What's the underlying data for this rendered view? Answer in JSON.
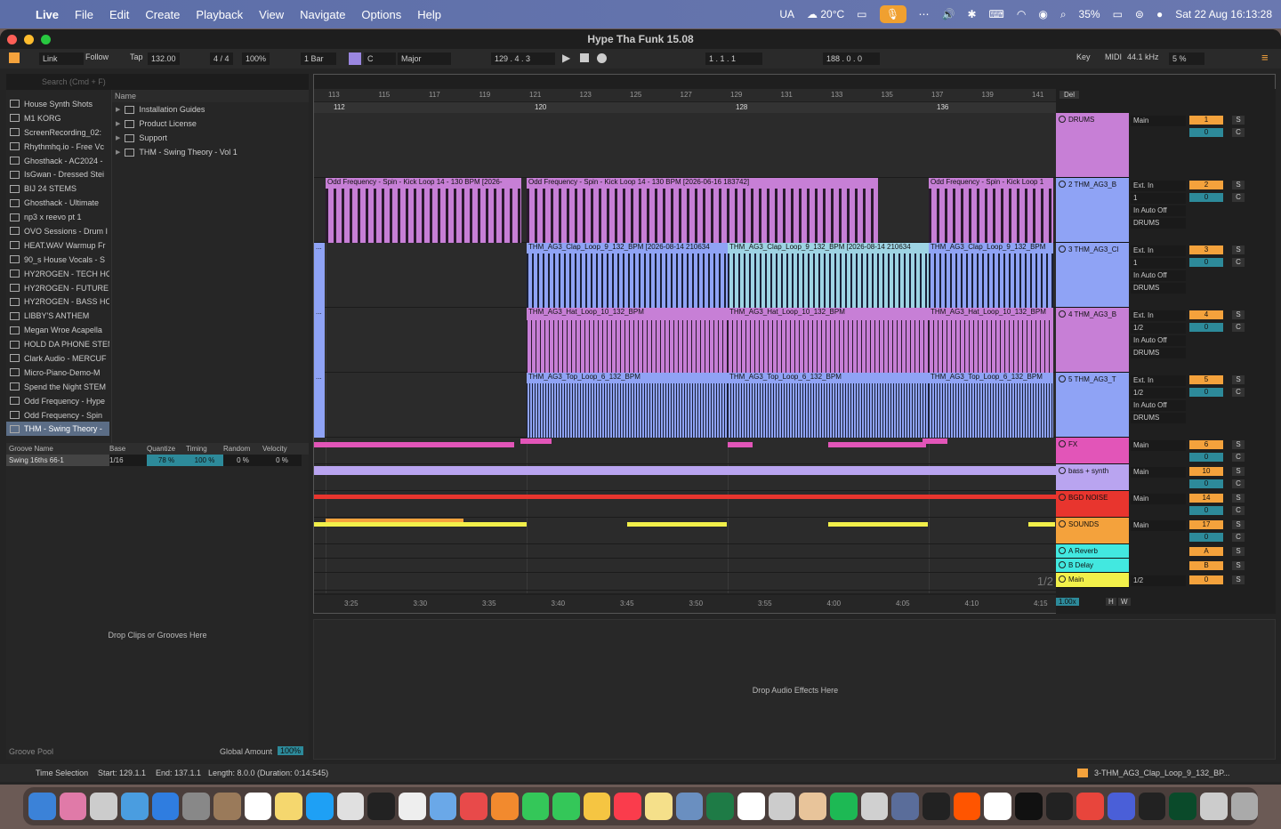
{
  "menubar": {
    "app": "Live",
    "items": [
      "File",
      "Edit",
      "Create",
      "Playback",
      "View",
      "Navigate",
      "Options",
      "Help"
    ],
    "lang": "UA",
    "weather": "20°C",
    "battery": "35%",
    "datetime": "Sat 22 Aug  16:13:28"
  },
  "window": {
    "title": "Hype Tha Funk 15.08"
  },
  "control": {
    "link": "Link",
    "follow": "Follow",
    "tap": "Tap",
    "tempo": "132.00",
    "sig": "4 / 4",
    "zoom": "100%",
    "quant": "1 Bar",
    "key": "C",
    "scale": "Major",
    "pos": "129 .  4 .  3",
    "loop_start": "1 .  1 .  1",
    "loop_len": "188 .  0 .  0",
    "keylbl": "Key",
    "midi": "MIDI",
    "rate": "44.1 kHz",
    "cpu": "5 %"
  },
  "browser": {
    "search_placeholder": "Search (Cmd + F)",
    "places": [
      "House Synth Shots",
      "M1 KORG",
      "ScreenRecording_02:",
      "Rhythmhq.io - Free Vc",
      "Ghosthack - AC2024 -",
      "IsGwan - Dressed Stei",
      "BIJ 24 STEMS",
      "Ghosthack - Ultimate",
      "np3 x reevo pt 1",
      "OVO Sessions - Drum I",
      "HEAT.WAV Warmup Fr",
      "90_s House Vocals - S",
      "HY2ROGEN - TECH HO",
      "HY2ROGEN - FUTURE",
      "HY2ROGEN - BASS HO",
      "LIBBY'S ANTHEM",
      "Megan Wroe Acapella",
      "HOLD DA PHONE STEN",
      "Clark Audio - MERCUF",
      "Micro-Piano-Demo-M",
      "Spend the Night STEM",
      "Odd Frequency - Hype",
      "Odd Frequency - Spin",
      "THM - Swing Theory -"
    ],
    "name_header": "Name",
    "files": [
      "Installation Guides",
      "Product License",
      "Support",
      "THM - Swing Theory - Vol 1"
    ]
  },
  "groove": {
    "headers": [
      "Groove Name",
      "Base",
      "Quantize",
      "Timing",
      "Random",
      "Velocity"
    ],
    "row": {
      "name": "Swing 16ths 66-1",
      "base": "1/16",
      "quantize": "78 %",
      "timing": "100 %",
      "random": "0 %",
      "velocity": "0 %"
    },
    "drop": "Drop Clips or Grooves Here",
    "pool": "Groove Pool",
    "global": "Global Amount",
    "global_val": "100%"
  },
  "ruler": {
    "bars": [
      "113",
      "115",
      "117",
      "119",
      "121",
      "123",
      "125",
      "127",
      "129",
      "131",
      "133",
      "135",
      "137",
      "139",
      "141"
    ],
    "markers": [
      "112",
      "120",
      "128",
      "136"
    ],
    "times": [
      "3:25",
      "3:30",
      "3:35",
      "3:40",
      "3:45",
      "3:50",
      "3:55",
      "4:00",
      "4:05",
      "4:10",
      "4:15"
    ],
    "fraction": "1/2"
  },
  "clips": {
    "kick": "Odd Frequency - Spin - Kick Loop 14 - 130 BPM [2026-",
    "kick2": "Odd Frequency - Spin - Kick Loop 14 - 130 BPM [2026-06-16 183742]",
    "kick3": "Odd Frequency - Spin - Kick Loop 1",
    "clap": "THM_AG3_Clap_Loop_9_132_BPM [2026-08-14 210634",
    "clap3": "THM_AG3_Clap_Loop_9_132_BPM",
    "hat": "THM_AG3_Hat_Loop_10_132_BPM",
    "top": "THM_AG3_Top_Loop_6_132_BPM",
    "dots": "..."
  },
  "tracks": [
    {
      "name": "DRUMS",
      "io1": "Main",
      "num": "1"
    },
    {
      "name": "2 THM_AG3_B",
      "io1": "Ext. In",
      "io2": "1",
      "io3": "In  Auto  Off",
      "io4": "DRUMS",
      "num": "2"
    },
    {
      "name": "3 THM_AG3_Cl",
      "io1": "Ext. In",
      "io2": "1",
      "io3": "In  Auto  Off",
      "io4": "DRUMS",
      "num": "3"
    },
    {
      "name": "4 THM_AG3_B",
      "io1": "Ext. In",
      "io2": "1/2",
      "io3": "In  Auto  Off",
      "io4": "DRUMS",
      "num": "4"
    },
    {
      "name": "5 THM_AG3_T",
      "io1": "Ext. In",
      "io2": "1/2",
      "io3": "In  Auto  Off",
      "io4": "DRUMS",
      "num": "5"
    },
    {
      "name": "FX",
      "io1": "Main",
      "num": "6"
    },
    {
      "name": "bass + synth",
      "io1": "Main",
      "num": "10"
    },
    {
      "name": "BGD NOISE",
      "io1": "Main",
      "num": "14"
    },
    {
      "name": "SOUNDS",
      "io1": "Main",
      "num": "17"
    },
    {
      "name": "A Reverb",
      "num": "A"
    },
    {
      "name": "B Delay",
      "num": "B"
    },
    {
      "name": "Main",
      "io1": "1/2",
      "num": "0"
    }
  ],
  "mixer": {
    "del": "Del",
    "zero": "0",
    "c": "C",
    "s": "S",
    "inf": "-∞",
    "post": "Post",
    "main_db": "-6.0",
    "zoom": "1.00x",
    "h": "H",
    "w": "W"
  },
  "device": {
    "drop": "Drop Audio Effects Here"
  },
  "status": {
    "sel": "Time Selection",
    "start": "Start: 129.1.1",
    "end": "End: 137.1.1",
    "len": "Length: 8.0.0 (Duration: 0:14:545)",
    "clip": "3-THM_AG3_Clap_Loop_9_132_BP..."
  },
  "colors": {
    "purple": "#c77fd6",
    "blue": "#8fa3f5",
    "pink": "#e255b8",
    "red": "#e8352e",
    "orange": "#f4a23c",
    "cyan": "#42e8e0",
    "yellow": "#f2f04a",
    "lilac": "#b9a4f0"
  }
}
